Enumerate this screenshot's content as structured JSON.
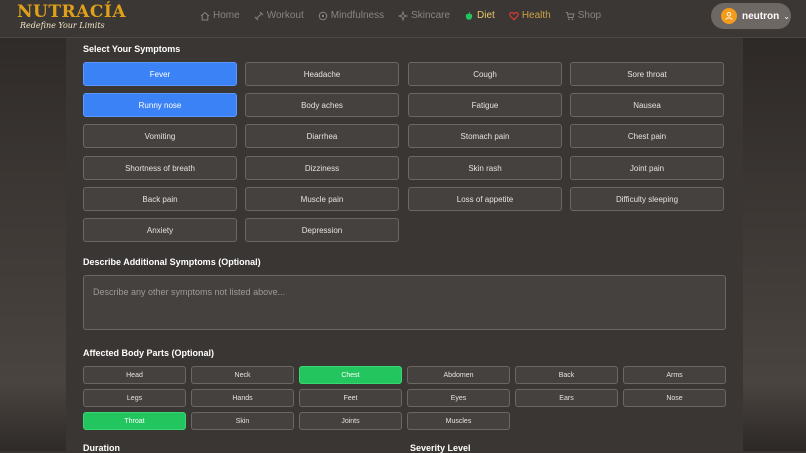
{
  "brand": {
    "name": "NUTRACÍA",
    "tagline": "Redefine Your Limits"
  },
  "nav": [
    {
      "label": "Home",
      "icon": "home-icon"
    },
    {
      "label": "Workout",
      "icon": "dumbbell-icon"
    },
    {
      "label": "Mindfulness",
      "icon": "mind-icon"
    },
    {
      "label": "Skincare",
      "icon": "sparkle-icon"
    },
    {
      "label": "Diet",
      "icon": "apple-icon"
    },
    {
      "label": "Health",
      "icon": "heart-icon"
    },
    {
      "label": "Shop",
      "icon": "cart-icon"
    }
  ],
  "user": {
    "name": "neutron"
  },
  "symptoms": {
    "title": "Select Your Symptoms",
    "items": [
      "Fever",
      "Headache",
      "Cough",
      "Sore throat",
      "Runny nose",
      "Body aches",
      "Fatigue",
      "Nausea",
      "Vomiting",
      "Diarrhea",
      "Stomach pain",
      "Chest pain",
      "Shortness of breath",
      "Dizziness",
      "Skin rash",
      "Joint pain",
      "Back pain",
      "Muscle pain",
      "Loss of appetite",
      "Difficulty sleeping",
      "Anxiety",
      "Depression"
    ],
    "selected": [
      "Fever",
      "Runny nose"
    ]
  },
  "additional": {
    "title": "Describe Additional Symptoms (Optional)",
    "placeholder": "Describe any other symptoms not listed above..."
  },
  "body_parts": {
    "title": "Affected Body Parts (Optional)",
    "items": [
      "Head",
      "Neck",
      "Chest",
      "Abdomen",
      "Back",
      "Arms",
      "Legs",
      "Hands",
      "Feet",
      "Eyes",
      "Ears",
      "Nose",
      "Throat",
      "Skin",
      "Joints",
      "Muscles"
    ],
    "selected": [
      "Chest",
      "Throat"
    ]
  },
  "duration": {
    "title": "Duration"
  },
  "severity": {
    "title": "Severity Level"
  },
  "colors": {
    "selected_symptom": "#3b82f6",
    "selected_body": "#22c55e",
    "brand": "#e0a11a",
    "avatar": "#f49b1a"
  }
}
